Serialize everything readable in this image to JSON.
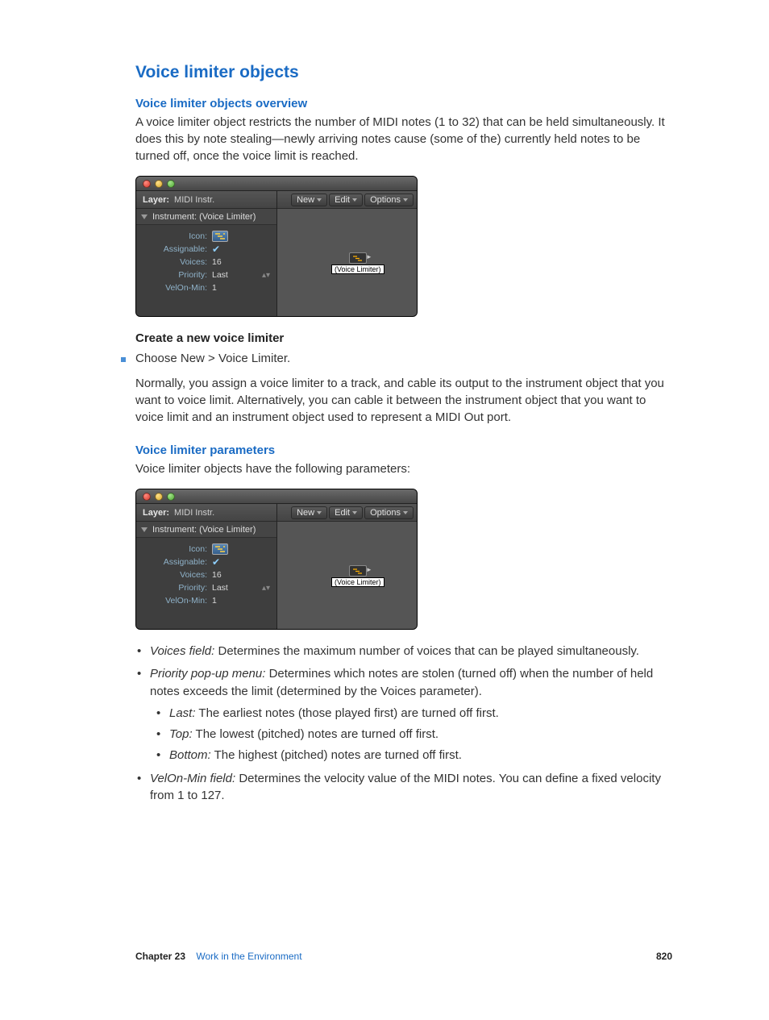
{
  "section_title": "Voice limiter objects",
  "overview": {
    "heading": "Voice limiter objects overview",
    "para": "A voice limiter object restricts the number of MIDI notes (1 to 32) that can be held simultaneously. It does this by note stealing—newly arriving notes cause (some of the) currently held notes to be turned off, once the voice limit is reached."
  },
  "create": {
    "heading": "Create a new voice limiter",
    "step": "Choose New > Voice Limiter.",
    "para": "Normally, you assign a voice limiter to a track, and cable its output to the instrument object that you want to voice limit. Alternatively, you can cable it between the instrument object that you want to voice limit and an instrument object used to represent a MIDI Out port."
  },
  "params": {
    "heading": "Voice limiter parameters",
    "intro": "Voice limiter objects have the following parameters:",
    "items": {
      "voices_term": "Voices field:",
      "voices_desc": " Determines the maximum number of voices that can be played simultaneously.",
      "priority_term": "Priority pop-up menu:",
      "priority_desc": " Determines which notes are stolen (turned off) when the number of held notes exceeds the limit (determined by the Voices parameter).",
      "last_term": "Last:",
      "last_desc": " The earliest notes (those played first) are turned off first.",
      "top_term": "Top:",
      "top_desc": " The lowest (pitched) notes are turned off first.",
      "bottom_term": "Bottom:",
      "bottom_desc": " The highest (pitched) notes are turned off first.",
      "velon_term": "VelOn-Min field:",
      "velon_desc": " Determines the velocity value of the MIDI notes. You can define a fixed velocity from 1 to 127."
    }
  },
  "window": {
    "layer_label": "Layer:",
    "layer_value": "MIDI Instr.",
    "instrument_row": "Instrument: (Voice Limiter)",
    "params": {
      "icon": "Icon:",
      "assignable": "Assignable:",
      "voices_label": "Voices:",
      "voices_value": "16",
      "priority_label": "Priority:",
      "priority_value": "Last",
      "velon_label": "VelOn-Min:",
      "velon_value": "1"
    },
    "toolbar": {
      "new": "New",
      "edit": "Edit",
      "options": "Options"
    },
    "object_label": "(Voice Limiter)"
  },
  "footer": {
    "chapter_label": "Chapter  23",
    "chapter_name": "Work in the Environment",
    "page": "820"
  }
}
